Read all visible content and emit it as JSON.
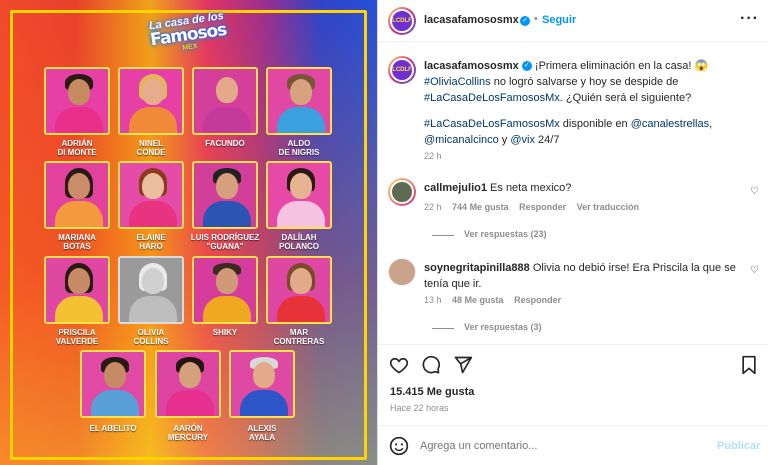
{
  "poster": {
    "logo": {
      "line1": "La casa de los",
      "line2": "Famosos",
      "line3": "MEX"
    },
    "contestants": [
      {
        "first": "ADRIÁN",
        "last": "DI MONTE"
      },
      {
        "first": "NINEL",
        "last": "CONDE"
      },
      {
        "first": "FACUNDO",
        "last": ""
      },
      {
        "first": "ALDO",
        "last": "DE NIGRIS"
      },
      {
        "first": "MARIANA",
        "last": "BOTAS"
      },
      {
        "first": "ELAINE",
        "last": "HARO"
      },
      {
        "first": "LUIS RODRÍGUEZ",
        "last": "\"GUANA\""
      },
      {
        "first": "DALÍLAH",
        "last": "POLANCO"
      },
      {
        "first": "PRISCILA",
        "last": "VALVERDE"
      },
      {
        "first": "OLIVIA",
        "last": "COLLINS"
      },
      {
        "first": "SHIKY",
        "last": ""
      },
      {
        "first": "MAR",
        "last": "CONTRERAS"
      },
      {
        "first": "EL ABELITO",
        "last": ""
      },
      {
        "first": "AARÓN",
        "last": "MERCURY"
      },
      {
        "first": "ALEXIS",
        "last": "AYALA"
      }
    ],
    "colors": {
      "frame": "#ffd400"
    }
  },
  "header": {
    "username": "lacasafamososmx",
    "separator": "•",
    "follow_label": "Seguir",
    "more_icon": "more-horizontal-icon",
    "avatar_text": "LCDLF"
  },
  "caption": {
    "username": "lacasafamososmx",
    "t1": "¡Primera eliminación en la casa! 😱",
    "tag1": "#OliviaCollins",
    "t2": " no logró salvarse y hoy se despide de",
    "tag2": "#LaCasaDeLosFamososMx",
    "t3": ". ¿Quién será el siguiente?",
    "tag3": "#LaCasaDeLosFamososMx",
    "t4": " disponible en ",
    "mention1": "@canalestrellas",
    "t5": ",",
    "mention2": "@micanalcinco",
    "t6": " y ",
    "mention3": "@vix",
    "t7": " 24/7",
    "time": "22 h"
  },
  "comments": [
    {
      "username": "callmejulio1",
      "text": "Es neta mexico?",
      "time": "22 h",
      "likes": "744 Me gusta",
      "reply": "Responder",
      "translate": "Ver traducción",
      "replies": "Ver respuestas (23)"
    },
    {
      "username": "soynegritapinilla888",
      "text": "Olivia no debió irse! Era Priscila la que se tenía que ir.",
      "time": "13 h",
      "likes": "48 Me gusta",
      "reply": "Responder",
      "replies": "Ver respuestas (3)"
    }
  ],
  "post": {
    "likes": "15.415 Me gusta",
    "time_ago": "Hace 22 horas"
  },
  "composer": {
    "placeholder": "Agrega un comentario...",
    "publish_label": "Publicar"
  },
  "accent": "#0095f6"
}
